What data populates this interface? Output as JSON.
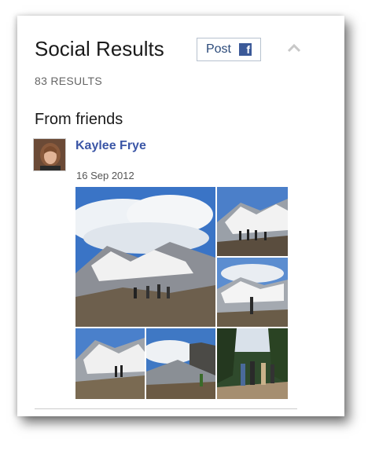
{
  "panel": {
    "title": "Social Results",
    "post_label": "Post",
    "fb_glyph": "f",
    "results_count": "83 RESULTS"
  },
  "section": {
    "title": "From friends"
  },
  "post": {
    "author": "Kaylee Frye",
    "date": "16 Sep 2012"
  },
  "colors": {
    "link": "#3b56a6",
    "facebook": "#3b5998",
    "muted": "#666666"
  },
  "icons": [
    "facebook-icon",
    "chevron-up-icon"
  ]
}
